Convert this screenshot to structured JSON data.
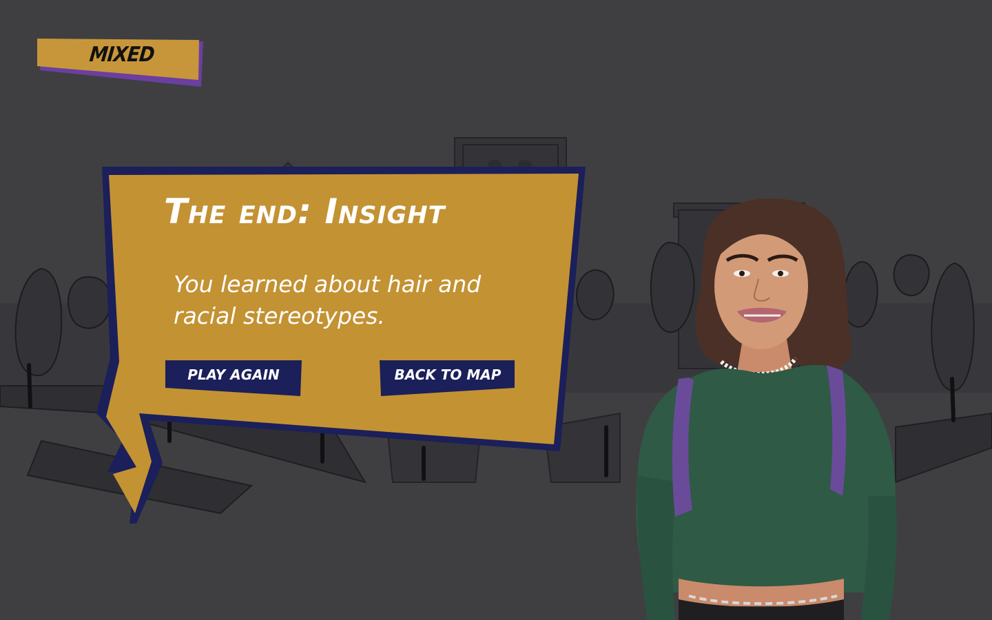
{
  "chapter": {
    "label": "MIXED"
  },
  "dialog": {
    "title": "The end: Insight",
    "message": "You learned about hair and racial stereotypes."
  },
  "buttons": {
    "play_again": "PLAY AGAIN",
    "back_to_map": "BACK TO MAP"
  },
  "colors": {
    "background": "#3f3f41",
    "bubble_fill": "#c39233",
    "bubble_border": "#1b1f5a",
    "button_fill": "#1b1f5a",
    "tag_fill": "#c8963a",
    "tag_shadow": "#6b3fa0"
  }
}
